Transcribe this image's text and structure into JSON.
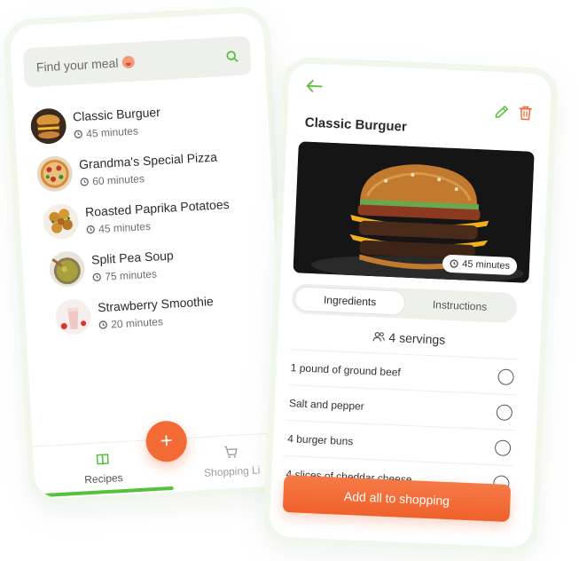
{
  "colors": {
    "accent_green": "#55c13d",
    "accent_orange": "#f46a35"
  },
  "list_screen": {
    "search": {
      "placeholder": "Find your meal"
    },
    "meals": [
      {
        "name": "Classic Burguer",
        "time": "45 minutes",
        "icon": "burger-thumb"
      },
      {
        "name": "Grandma's Special Pizza",
        "time": "60 minutes",
        "icon": "pizza-thumb"
      },
      {
        "name": "Roasted Paprika Potatoes",
        "time": "45 minutes",
        "icon": "potatoes-thumb"
      },
      {
        "name": "Split Pea Soup",
        "time": "75 minutes",
        "icon": "soup-thumb"
      },
      {
        "name": "Strawberry Smoothie",
        "time": "20 minutes",
        "icon": "smoothie-thumb"
      }
    ],
    "nav": {
      "recipes": "Recipes",
      "shopping": "Shopping Li"
    },
    "fab_label": "+"
  },
  "detail_screen": {
    "title": "Classic Burguer",
    "time": "45 minutes",
    "tabs": [
      "Ingredients",
      "Instructions"
    ],
    "active_tab": "Ingredients",
    "servings": "4 servings",
    "ingredients": [
      "1 pound of ground beef",
      "Salt and pepper",
      "4 burger buns",
      "4 slices of cheddar cheese"
    ],
    "add_button": "Add all to shopping"
  }
}
